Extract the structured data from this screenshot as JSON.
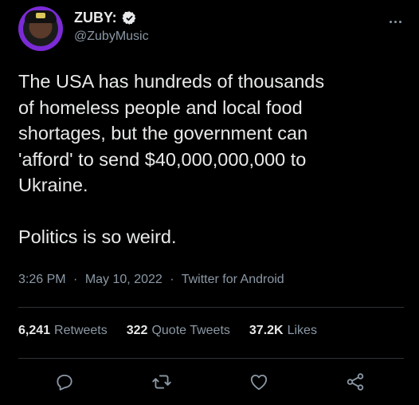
{
  "user": {
    "display_name": "ZUBY:",
    "handle": "@ZubyMusic"
  },
  "tweet": {
    "text": "The USA has hundreds of thousands\nof homeless people and local food\nshortages, but the government can\n'afford' to send $40,000,000,000 to\nUkraine.\n\nPolitics is so weird.",
    "time": "3:26 PM",
    "date": "May 10, 2022",
    "source": "Twitter for Android",
    "separator": "·"
  },
  "stats": {
    "retweets_count": "6,241",
    "retweets_label": "Retweets",
    "quotes_count": "322",
    "quotes_label": "Quote Tweets",
    "likes_count": "37.2K",
    "likes_label": "Likes"
  },
  "icons": {
    "verified": "verified-badge-icon",
    "more": "more-options-icon",
    "reply": "reply-icon",
    "retweet": "retweet-icon",
    "like": "like-icon",
    "share": "share-icon"
  },
  "colors": {
    "background": "#000000",
    "text": "#e7e9ea",
    "secondary": "#8b98a5",
    "divider": "#2f3336"
  }
}
